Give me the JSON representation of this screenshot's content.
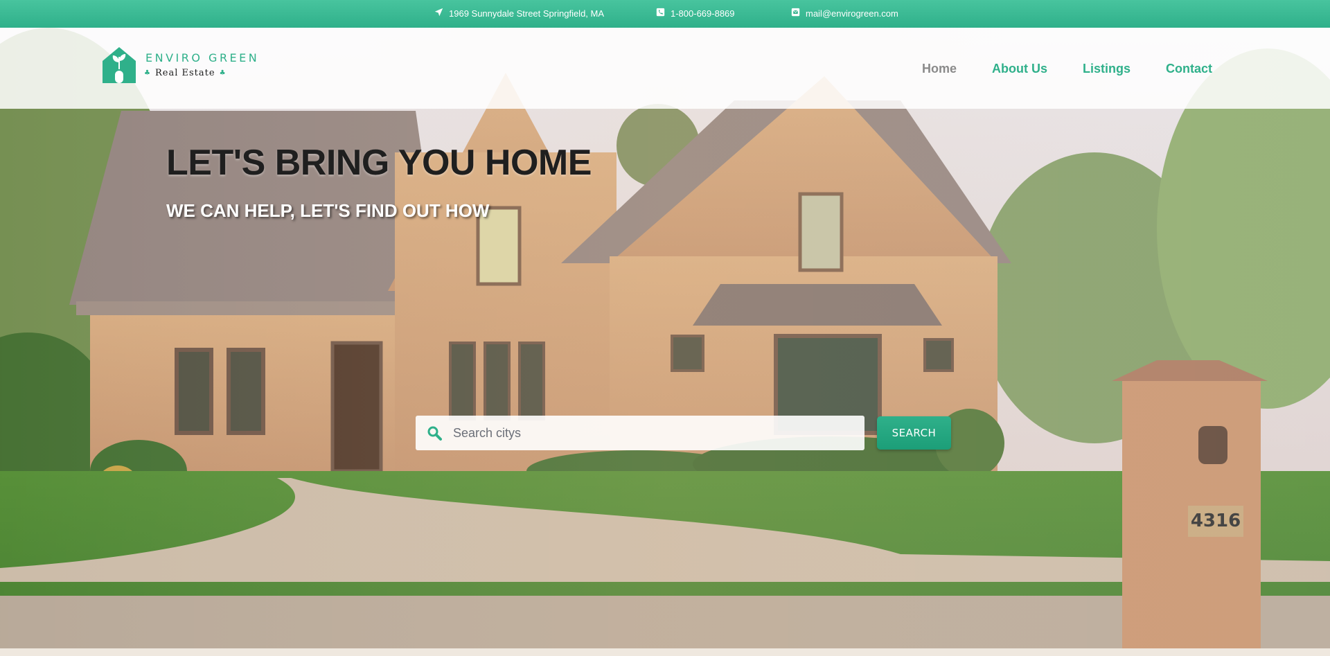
{
  "topbar": {
    "address": "1969 Sunnydale Street Springfield, MA",
    "phone": "1-800-669-8869",
    "email": "mail@envirogreen.com"
  },
  "logo": {
    "title": "ENVIRO GREEN",
    "subtitle": "Real Estate"
  },
  "nav": {
    "items": [
      {
        "label": "Home",
        "active": true
      },
      {
        "label": "About Us",
        "active": false
      },
      {
        "label": "Listings",
        "active": false
      },
      {
        "label": "Contact",
        "active": false
      }
    ]
  },
  "hero": {
    "title": "LET'S BRING YOU HOME",
    "subtitle": "WE CAN HELP, LET'S FIND OUT HOW",
    "house_number": "4316"
  },
  "search": {
    "placeholder": "Search citys",
    "value": "",
    "button_label": "SEARCH"
  },
  "colors": {
    "brand": "#2fb08a",
    "nav_active": "#8a8a8a"
  },
  "icons": {
    "address": "location-arrow-icon",
    "phone": "phone-square-icon",
    "email": "envelope-square-icon",
    "search": "search-icon"
  }
}
